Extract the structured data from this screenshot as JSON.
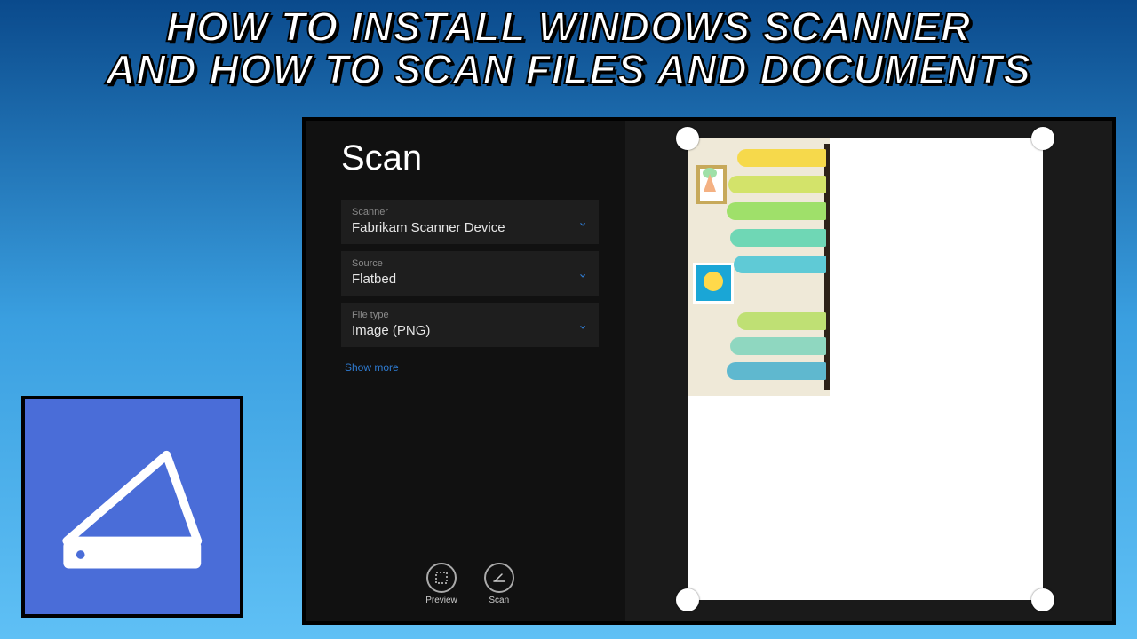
{
  "headline": {
    "line1": "HOW TO INSTALL WINDOWS SCANNER",
    "line2": "AND HOW TO SCAN FILES AND DOCUMENTS"
  },
  "app": {
    "title": "Scan",
    "fields": {
      "scanner": {
        "label": "Scanner",
        "value": "Fabrikam Scanner Device"
      },
      "source": {
        "label": "Source",
        "value": "Flatbed"
      },
      "filetype": {
        "label": "File type",
        "value": "Image (PNG)"
      }
    },
    "show_more": "Show more",
    "commands": {
      "preview": "Preview",
      "scan": "Scan"
    }
  }
}
